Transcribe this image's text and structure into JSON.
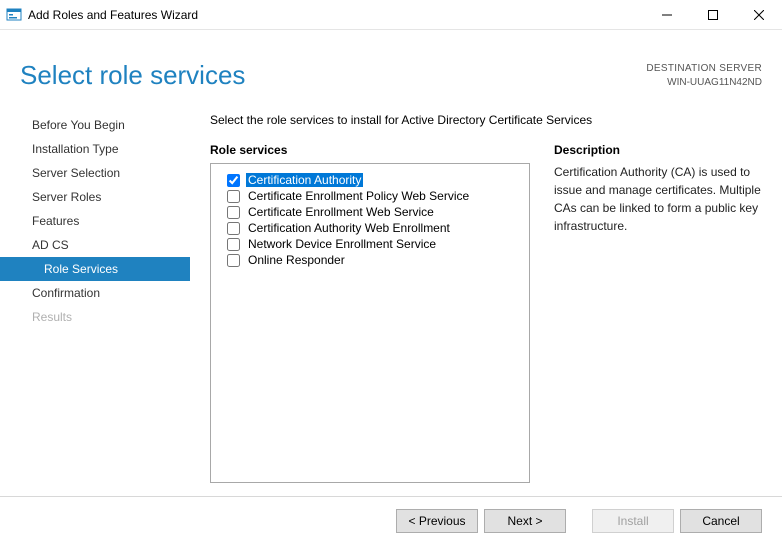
{
  "window": {
    "title": "Add Roles and Features Wizard"
  },
  "header": {
    "page_title": "Select role services",
    "destination_label": "DESTINATION SERVER",
    "destination_value": "WIN-UUAG11N42ND"
  },
  "nav": {
    "items": [
      {
        "label": "Before You Begin",
        "state": "normal"
      },
      {
        "label": "Installation Type",
        "state": "normal"
      },
      {
        "label": "Server Selection",
        "state": "normal"
      },
      {
        "label": "Server Roles",
        "state": "normal"
      },
      {
        "label": "Features",
        "state": "normal"
      },
      {
        "label": "AD CS",
        "state": "normal"
      },
      {
        "label": "Role Services",
        "state": "active"
      },
      {
        "label": "Confirmation",
        "state": "normal"
      },
      {
        "label": "Results",
        "state": "disabled"
      }
    ]
  },
  "main": {
    "intro": "Select the role services to install for Active Directory Certificate Services",
    "role_services_title": "Role services",
    "description_title": "Description",
    "description_text": "Certification Authority (CA) is used to issue and manage certificates. Multiple CAs can be linked to form a public key infrastructure.",
    "role_services": [
      {
        "label": "Certification Authority",
        "checked": true,
        "selected": true
      },
      {
        "label": "Certificate Enrollment Policy Web Service",
        "checked": false,
        "selected": false
      },
      {
        "label": "Certificate Enrollment Web Service",
        "checked": false,
        "selected": false
      },
      {
        "label": "Certification Authority Web Enrollment",
        "checked": false,
        "selected": false
      },
      {
        "label": "Network Device Enrollment Service",
        "checked": false,
        "selected": false
      },
      {
        "label": "Online Responder",
        "checked": false,
        "selected": false
      }
    ]
  },
  "footer": {
    "previous": "< Previous",
    "next": "Next >",
    "install": "Install",
    "cancel": "Cancel"
  }
}
